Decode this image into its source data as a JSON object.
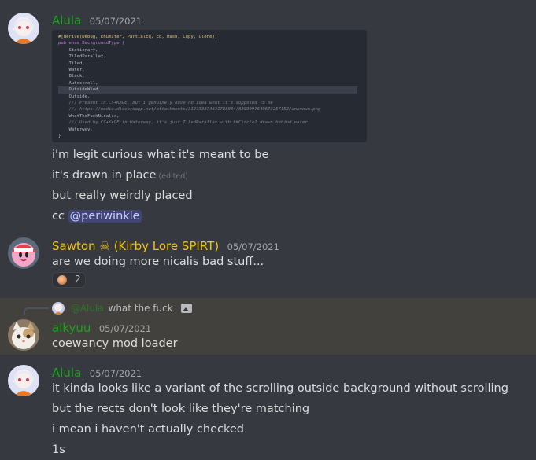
{
  "messages": {
    "m1": {
      "author": "Alula",
      "timestamp": "05/07/2021",
      "lines": [
        "i'm legit curious what it's meant to be",
        "it's drawn in place",
        "but really weirdly placed",
        "cc"
      ],
      "edited": "(edited)",
      "mention": "@periwinkle",
      "code": [
        "#[derive(Debug, EnumIter, PartialEq, Eq, Hash, Copy, Clone)]",
        "pub enum BackgroundType {",
        "    Stationary,",
        "    TiledParallax,",
        "    Tiled,",
        "    Water,",
        "    Black,",
        "    Autoscroll,",
        "    OutsideWind,",
        "    Outside,",
        "    /// Present in CS+KAGE, but I genuinely have no idea what it's supposed to be",
        "    /// https://media.discordapp.net/attachments/312733374831788034/8399997649673257152/unknown.png",
        "    WhatTheFuckNicalis,",
        "    /// Used by CS+KAGE in Waterway, it's just TiledParallax with bkCircle2 drawn behind water",
        "    Waterway,",
        "}"
      ]
    },
    "m2": {
      "author": "Sawton",
      "author_suffix": "(Kirby Lore SPIRT)",
      "timestamp": "05/07/2021",
      "line": "are we doing more nicalis bad stuff...",
      "reaction_count": "2"
    },
    "m3": {
      "reply_author": "@Alula",
      "reply_text": "what the fuck",
      "author": "alkyuu",
      "timestamp": "05/07/2021",
      "line": "coewancy mod loader"
    },
    "m4": {
      "author": "Alula",
      "timestamp": "05/07/2021",
      "lines": [
        "it kinda looks like a variant of the scrolling outside background without scrolling",
        "but the rects don't look like they're matching",
        "i mean i haven't actually checked",
        "1s"
      ]
    }
  },
  "colors": {
    "background": "#36393f",
    "highlight": "#42413d",
    "alula_name": "#1aa31a",
    "sawton_name": "#f1c40f",
    "mention": "#c9cdfb"
  }
}
